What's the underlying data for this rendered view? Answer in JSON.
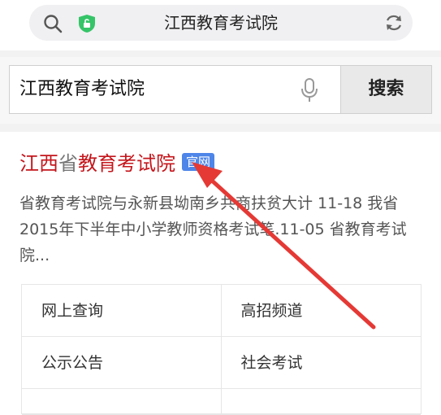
{
  "address_bar": {
    "url_text": "江西教育考试院"
  },
  "search": {
    "query": "江西教育考试院",
    "button_label": "搜索"
  },
  "result": {
    "title_part1": "江西",
    "title_part2": "省",
    "title_part3": "教育考试院",
    "badge": "官网",
    "snippet": "省教育考试院与永新县坳南乡共商扶贫大计 11-18 我省2015年下半年中小学教师资格考试笔.11-05 省教育考试院...",
    "links": [
      "网上查询",
      "高招频道",
      "公示公告",
      "社会考试"
    ]
  },
  "colors": {
    "title_red": "#c4161c",
    "badge_blue": "#4e85e8",
    "arrow_red": "#e53935"
  }
}
